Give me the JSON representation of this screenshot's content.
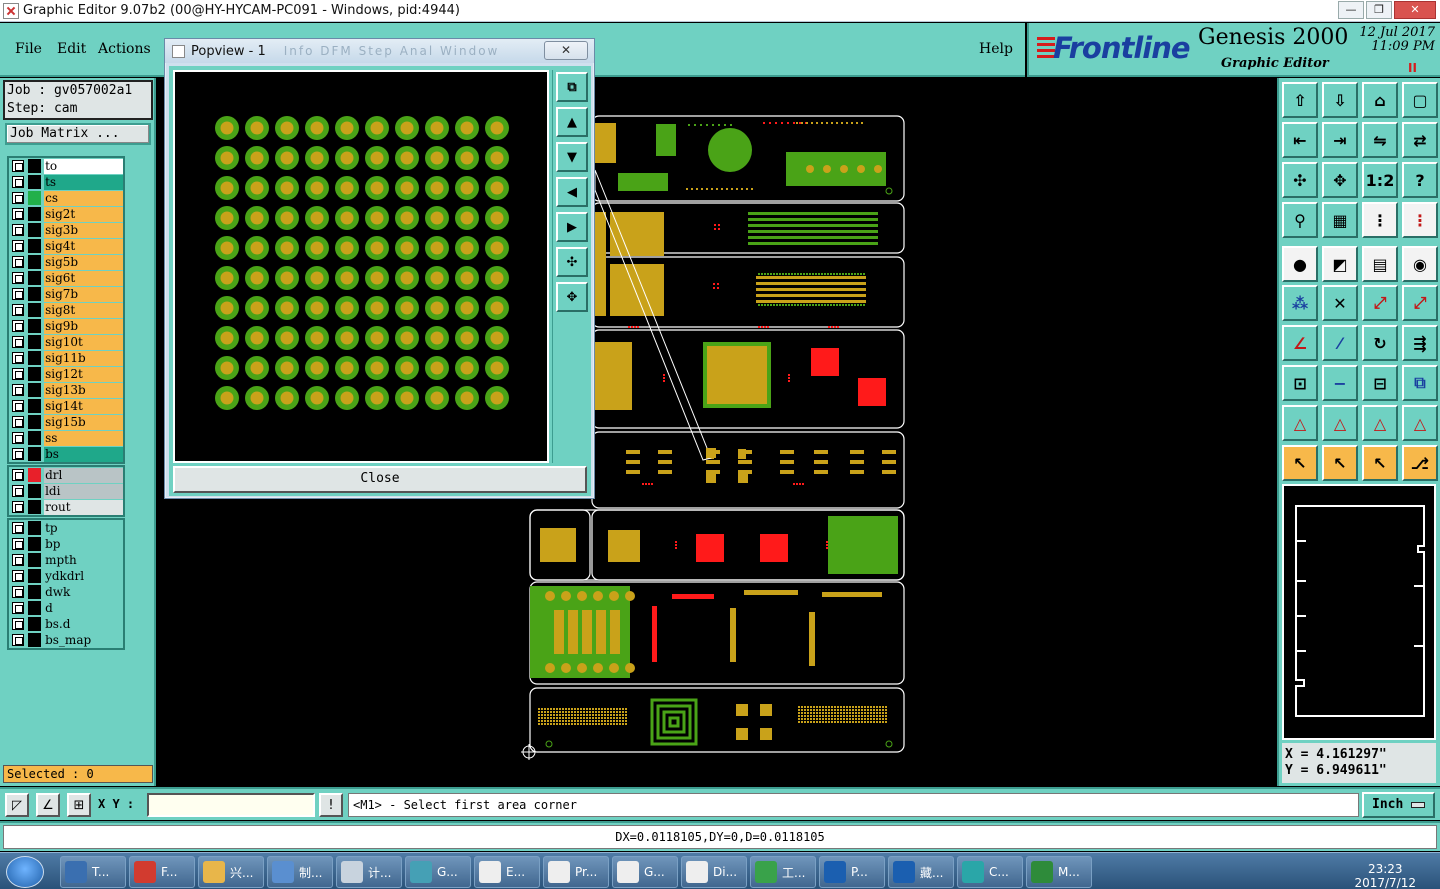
{
  "window": {
    "title": "Graphic Editor 9.07b2 (00@HY-HYCAM-PC091 - Windows, pid:4944)",
    "min": "—",
    "max": "❐",
    "close": "✕"
  },
  "menu": {
    "file": "File",
    "edit": "Edit",
    "actions": "Actions",
    "help": "Help"
  },
  "brand": {
    "name": "Frontline",
    "product": "Genesis 2000",
    "subtitle": "Graphic Editor",
    "date": "12  Jul  2017",
    "time": "11:09  PM",
    "marker": "II"
  },
  "job": {
    "job_line": "Job : gv057002a1",
    "step_line": "Step: cam",
    "matrix_button": "Job Matrix ..."
  },
  "layer_groups": [
    {
      "layers": [
        {
          "name": "to",
          "swatch": "#000000",
          "bg": "#ffffff"
        },
        {
          "name": "ts",
          "swatch": "#000000",
          "bg": "#1fa88a"
        },
        {
          "name": "cs",
          "swatch": "#22b04a",
          "bg": "#f7b84a"
        },
        {
          "name": "sig2t",
          "swatch": "#000000",
          "bg": "#f7b84a"
        },
        {
          "name": "sig3b",
          "swatch": "#000000",
          "bg": "#f7b84a"
        },
        {
          "name": "sig4t",
          "swatch": "#000000",
          "bg": "#f7b84a"
        },
        {
          "name": "sig5b",
          "swatch": "#000000",
          "bg": "#f7b84a"
        },
        {
          "name": "sig6t",
          "swatch": "#000000",
          "bg": "#f7b84a"
        },
        {
          "name": "sig7b",
          "swatch": "#000000",
          "bg": "#f7b84a"
        },
        {
          "name": "sig8t",
          "swatch": "#000000",
          "bg": "#f7b84a"
        },
        {
          "name": "sig9b",
          "swatch": "#000000",
          "bg": "#f7b84a"
        },
        {
          "name": "sig10t",
          "swatch": "#000000",
          "bg": "#f7b84a"
        },
        {
          "name": "sig11b",
          "swatch": "#000000",
          "bg": "#f7b84a"
        },
        {
          "name": "sig12t",
          "swatch": "#000000",
          "bg": "#f7b84a"
        },
        {
          "name": "sig13b",
          "swatch": "#000000",
          "bg": "#f7b84a"
        },
        {
          "name": "sig14t",
          "swatch": "#000000",
          "bg": "#f7b84a"
        },
        {
          "name": "sig15b",
          "swatch": "#000000",
          "bg": "#f7b84a"
        },
        {
          "name": "ss",
          "swatch": "#000000",
          "bg": "#f7b84a"
        },
        {
          "name": "bs",
          "swatch": "#000000",
          "bg": "#1fa88a"
        }
      ]
    },
    {
      "layers": [
        {
          "name": "drl",
          "swatch": "#e8202a",
          "bg": "#b9c4c6"
        },
        {
          "name": "ldi",
          "swatch": "#000000",
          "bg": "#b9c4c6"
        },
        {
          "name": "rout",
          "swatch": "#000000",
          "bg": "#dfe5e5"
        }
      ]
    },
    {
      "layers": [
        {
          "name": "tp",
          "swatch": "#000000",
          "bg": "#6fd1c2"
        },
        {
          "name": "bp",
          "swatch": "#000000",
          "bg": "#6fd1c2"
        },
        {
          "name": "mpth",
          "swatch": "#000000",
          "bg": "#6fd1c2"
        },
        {
          "name": "ydkdrl",
          "swatch": "#000000",
          "bg": "#6fd1c2"
        },
        {
          "name": "dwk",
          "swatch": "#000000",
          "bg": "#6fd1c2"
        },
        {
          "name": "d",
          "swatch": "#000000",
          "bg": "#6fd1c2"
        },
        {
          "name": "bs.d",
          "swatch": "#000000",
          "bg": "#6fd1c2"
        },
        {
          "name": "bs_map",
          "swatch": "#000000",
          "bg": "#6fd1c2"
        }
      ]
    }
  ],
  "selected": "Selected : 0",
  "popview": {
    "title": "Popview - 1",
    "ghost_menu": "Info  DFM  Step  Anal  Window",
    "close_x": "✕",
    "close_button": "Close",
    "grid": {
      "rows": 10,
      "cols": 10
    }
  },
  "coords": {
    "x": "X = 4.161297\"",
    "y": "Y = 6.949611\""
  },
  "command": {
    "xy_label": "X Y :",
    "xy_value": "",
    "bang": "!",
    "message": "<M1> - Select first area corner",
    "unit": "Inch"
  },
  "status": "DX=0.0118105,DY=0,D=0.0118105",
  "taskbar": {
    "tasks": [
      "T...",
      "F...",
      "兴...",
      "制...",
      "计...",
      "G...",
      "E...",
      "Pr...",
      "G...",
      "Di...",
      "工...",
      "P...",
      "藏...",
      "C...",
      "M..."
    ],
    "clock_time": "23:23",
    "clock_date": "2017/7/12"
  },
  "colors": {
    "teal": "#6fd1c2",
    "pad_green": "#4aa317",
    "pad_gold": "#c9a21a",
    "pad_red": "#ff1a1a",
    "outline": "#ffffff"
  }
}
